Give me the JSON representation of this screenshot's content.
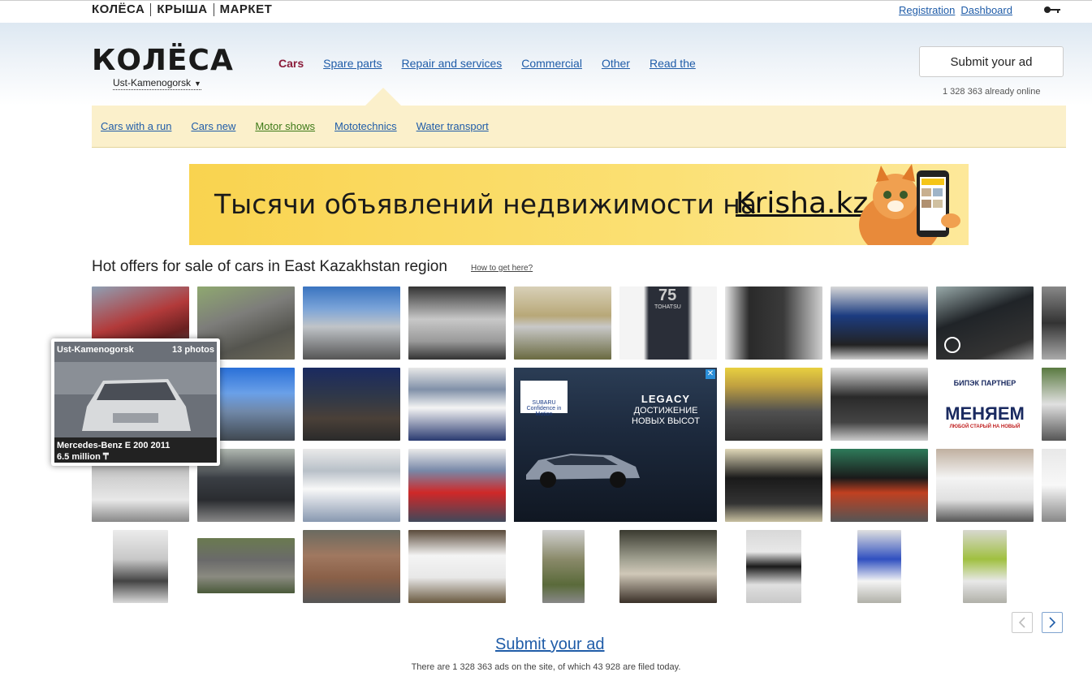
{
  "topbar": {
    "brands": [
      "КОЛЁСА",
      "КРЫША",
      "МАРКЕТ"
    ],
    "registration": "Registration",
    "dashboard": "Dashboard"
  },
  "header": {
    "logo": "КОЛЁСА",
    "city": "Ust-Kamenogorsk",
    "nav": [
      "Cars",
      "Spare parts",
      "Repair and services",
      "Commercial",
      "Other",
      "Read the"
    ],
    "submit": "Submit your ad",
    "online": "1 328 363 already online"
  },
  "subnav": [
    "Cars with a run",
    "Cars new",
    "Motor shows",
    "Mototechnics",
    "Water transport"
  ],
  "banner": {
    "text": "Тысячи объявлений недвижимости на",
    "site": "Krisha.kz"
  },
  "hot": {
    "title": "Hot offers for sale of cars in East Kazakhstan region",
    "help": "How to get here?"
  },
  "popup": {
    "city": "Ust-Kamenogorsk",
    "photos": "13 photos",
    "title": "Mercedes-Benz E 200 2011",
    "price": "6.5 million ₸"
  },
  "ad": {
    "brand": "SUBARU",
    "tagline": "Confidence in Motion",
    "headline": "LEGACY",
    "sub1": "ДОСТИЖЕНИЕ",
    "sub2": "НОВЫХ ВЫСОТ"
  },
  "tiles_text": {
    "bipek_name": "БИПЭК ПАРТНЕР",
    "bipek_main": "МЕНЯЕМ",
    "bipek_sub": "ЛЮБОЙ СТАРЫЙ НА НОВЫЙ",
    "tohatsu": "TOHATSU",
    "seventy_five": "75"
  },
  "footer": {
    "submit": "Submit your ad",
    "note": "There are 1 328 363 ads on the site, of which 43 928 are filed today."
  },
  "colors": {
    "link": "#1f5ca8",
    "active_nav": "#8b1c3a",
    "subnav_bg": "#fbf0cb",
    "banner_bg": "#f9d34f"
  }
}
